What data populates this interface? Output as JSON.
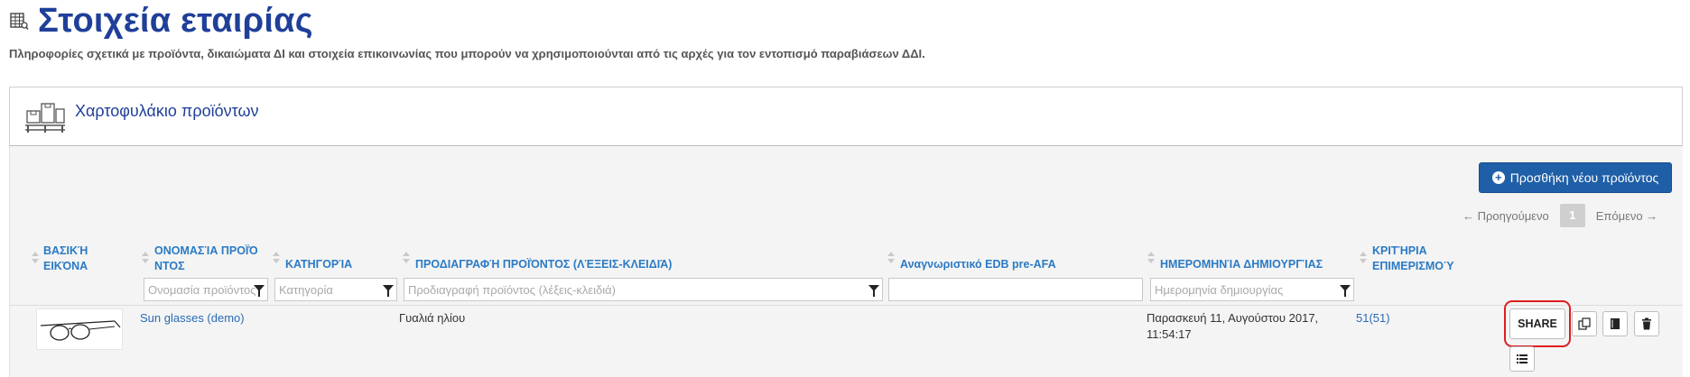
{
  "header": {
    "title": "Στοιχεία εταιρίας",
    "subtitle": "Πληροφορίες σχετικά με προϊόντα, δικαιώματα ΔΙ και στοιχεία επικοινωνίας που μπορούν να χρησιμοποιούνται από τις αρχές για τον εντοπισμό παραβιάσεων ΔΔΙ.",
    "icon": "table-icon"
  },
  "portfolio": {
    "title": "Χαρτοφυλάκιο προϊόντων",
    "icon": "pallet-boxes-icon"
  },
  "toolbar": {
    "add_label": "Προσθήκη νέου προϊόντος",
    "add_icon": "plus-circle-icon"
  },
  "pagination": {
    "prev": "← Προηγούμενο",
    "page": "1",
    "next": "Επόμενο →"
  },
  "table": {
    "columns": [
      {
        "line1": "ΒΑΣΙΚΉ",
        "line2": "ΕΙΚΌΝΑ"
      },
      {
        "line1": "ΟΝΟΜΑΣΊΑ ΠΡΟΪΌ",
        "line2": "ΝΤΟΣ"
      },
      {
        "line1": "ΚΑΤΗΓΟΡΊΑ",
        "line2": ""
      },
      {
        "line1": "ΠΡΟΔΙΑΓΡΑΦΉ ΠΡΟΪΌΝΤΟΣ (ΛΈΞΕΙΣ-ΚΛΕΙΔΙΆ)",
        "line2": ""
      },
      {
        "line1": "Αναγνωριστικό EDB pre-AFA",
        "line2": ""
      },
      {
        "line1": "ΗΜΕΡΟΜΗΝΊΑ ΔΗΜΙΟΥΡΓΊΑΣ",
        "line2": ""
      },
      {
        "line1": "ΚΡΙΤΉΡΙΑ",
        "line2": "ΕΠΙΜΕΡΙΣΜΟΎ"
      }
    ],
    "filters": {
      "name": "Ονομασία προϊόντος",
      "category": "Κατηγορία",
      "spec": "Προδιαγραφή προϊόντος (λέξεις-κλειδιά)",
      "edb": "",
      "date": "Ημερομηνία δημιουργίας"
    },
    "rows": [
      {
        "name": "Sun glasses (demo)",
        "category": "",
        "spec": "Γυαλιά ηλίου",
        "edb": "",
        "date_line1": "Παρασκευή 11, Αυγούστου 2017,",
        "date_line2": "11:54:17",
        "criteria": "51(51)",
        "share_label": "SHARE"
      }
    ]
  },
  "colors": {
    "title": "#1f3f99",
    "header_text": "#2a7ac4",
    "primary_button": "#1f5fa7",
    "highlight": "#e01d1d"
  }
}
